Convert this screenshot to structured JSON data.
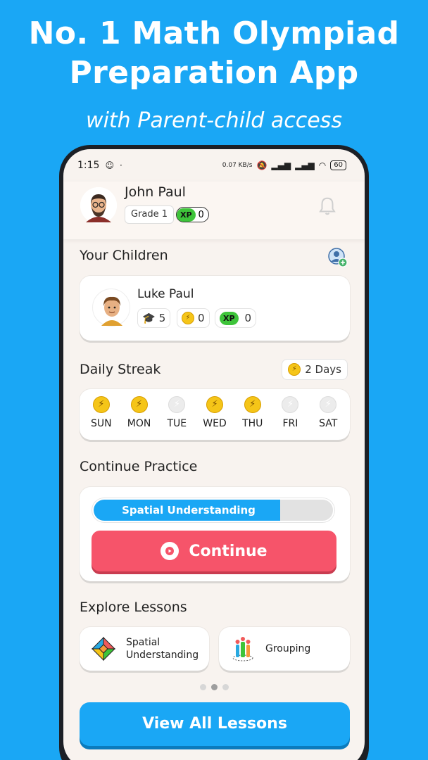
{
  "promo": {
    "headline_line1": "No. 1 Math Olympiad",
    "headline_line2": "Preparation App",
    "subline": "with Parent-child access"
  },
  "status_bar": {
    "time": "1:15",
    "net_speed": "0.07 KB/s",
    "battery": "60"
  },
  "profile": {
    "name": "John Paul",
    "grade": "Grade 1",
    "xp_badge": "XP",
    "xp_value": "0"
  },
  "children_section": {
    "title": "Your Children",
    "children": [
      {
        "name": "Luke Paul",
        "caps": "5",
        "coins": "0",
        "xp_badge": "XP",
        "xp": "0"
      }
    ]
  },
  "streak": {
    "title": "Daily Streak",
    "summary": "2 Days",
    "days": [
      {
        "label": "SUN",
        "active": true
      },
      {
        "label": "MON",
        "active": true
      },
      {
        "label": "TUE",
        "active": false
      },
      {
        "label": "WED",
        "active": true
      },
      {
        "label": "THU",
        "active": true
      },
      {
        "label": "FRI",
        "active": false
      },
      {
        "label": "SAT",
        "active": false
      }
    ]
  },
  "practice": {
    "title": "Continue Practice",
    "topic": "Spatial Understanding",
    "progress_percent": 78,
    "continue_label": "Continue"
  },
  "lessons": {
    "title": "Explore Lessons",
    "items": [
      {
        "label_line1": "Spatial",
        "label_line2": "Understanding",
        "icon": "tangram-icon"
      },
      {
        "label_line1": "Grouping",
        "label_line2": "",
        "icon": "grouping-icon"
      }
    ],
    "pager_total": 3,
    "pager_active": 1,
    "view_all_label": "View All Lessons"
  },
  "colors": {
    "background": "#1aa7f5",
    "continue": "#f6546a",
    "xp_green": "#3ec43a",
    "coin": "#f5c518"
  }
}
